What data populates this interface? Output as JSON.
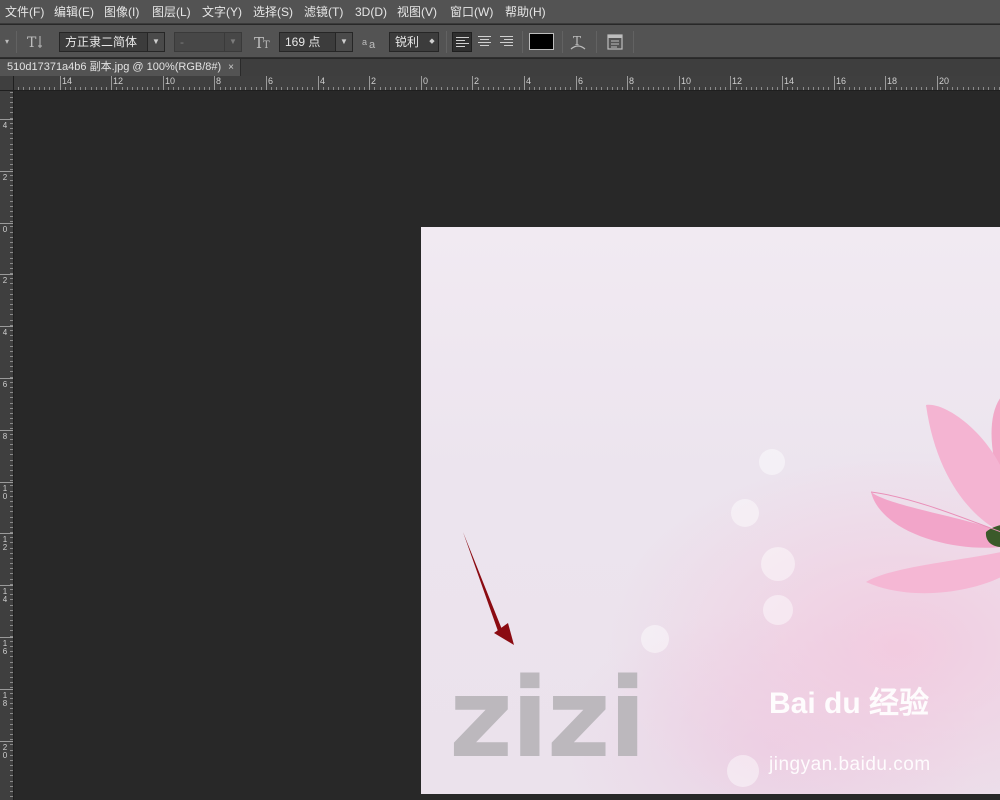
{
  "menu": [
    "文件(F)",
    "编辑(E)",
    "图像(I)",
    "图层(L)",
    "文字(Y)",
    "选择(S)",
    "滤镜(T)",
    "3D(D)",
    "视图(V)",
    "窗口(W)",
    "帮助(H)"
  ],
  "options": {
    "font_family": "方正隶二简体",
    "font_style": "-",
    "font_size": "169 点",
    "antialias": "锐利",
    "color_swatch": "#000000"
  },
  "document": {
    "tab_title": "510d17371a4b6 副本.jpg @ 100%(RGB/8#)",
    "close_glyph": "×"
  },
  "ruler_top_labels": [
    "6",
    "14",
    "12",
    "10",
    "8",
    "6",
    "4",
    "2",
    "0",
    "2",
    "4",
    "6",
    "8",
    "10",
    "12",
    "14",
    "16",
    "18",
    "20"
  ],
  "ruler_left_labels": [
    "4",
    "2",
    "0",
    "2",
    "4",
    "6",
    "8",
    "1\n0",
    "1\n2",
    "1\n4",
    "1\n6",
    "1\n8",
    "2\n0"
  ],
  "canvas": {
    "text_layer": "zizi",
    "watermark_logo": "Bai du 经验",
    "watermark_url": "jingyan.baidu.com",
    "arrow_color": "#8b0b12"
  },
  "icons": {
    "text_orientation": "text-orientation-icon",
    "font_size": "font-size-icon",
    "antialias": "antialias-icon",
    "warp_text": "warp-text-icon",
    "panels": "character-panel-icon"
  }
}
